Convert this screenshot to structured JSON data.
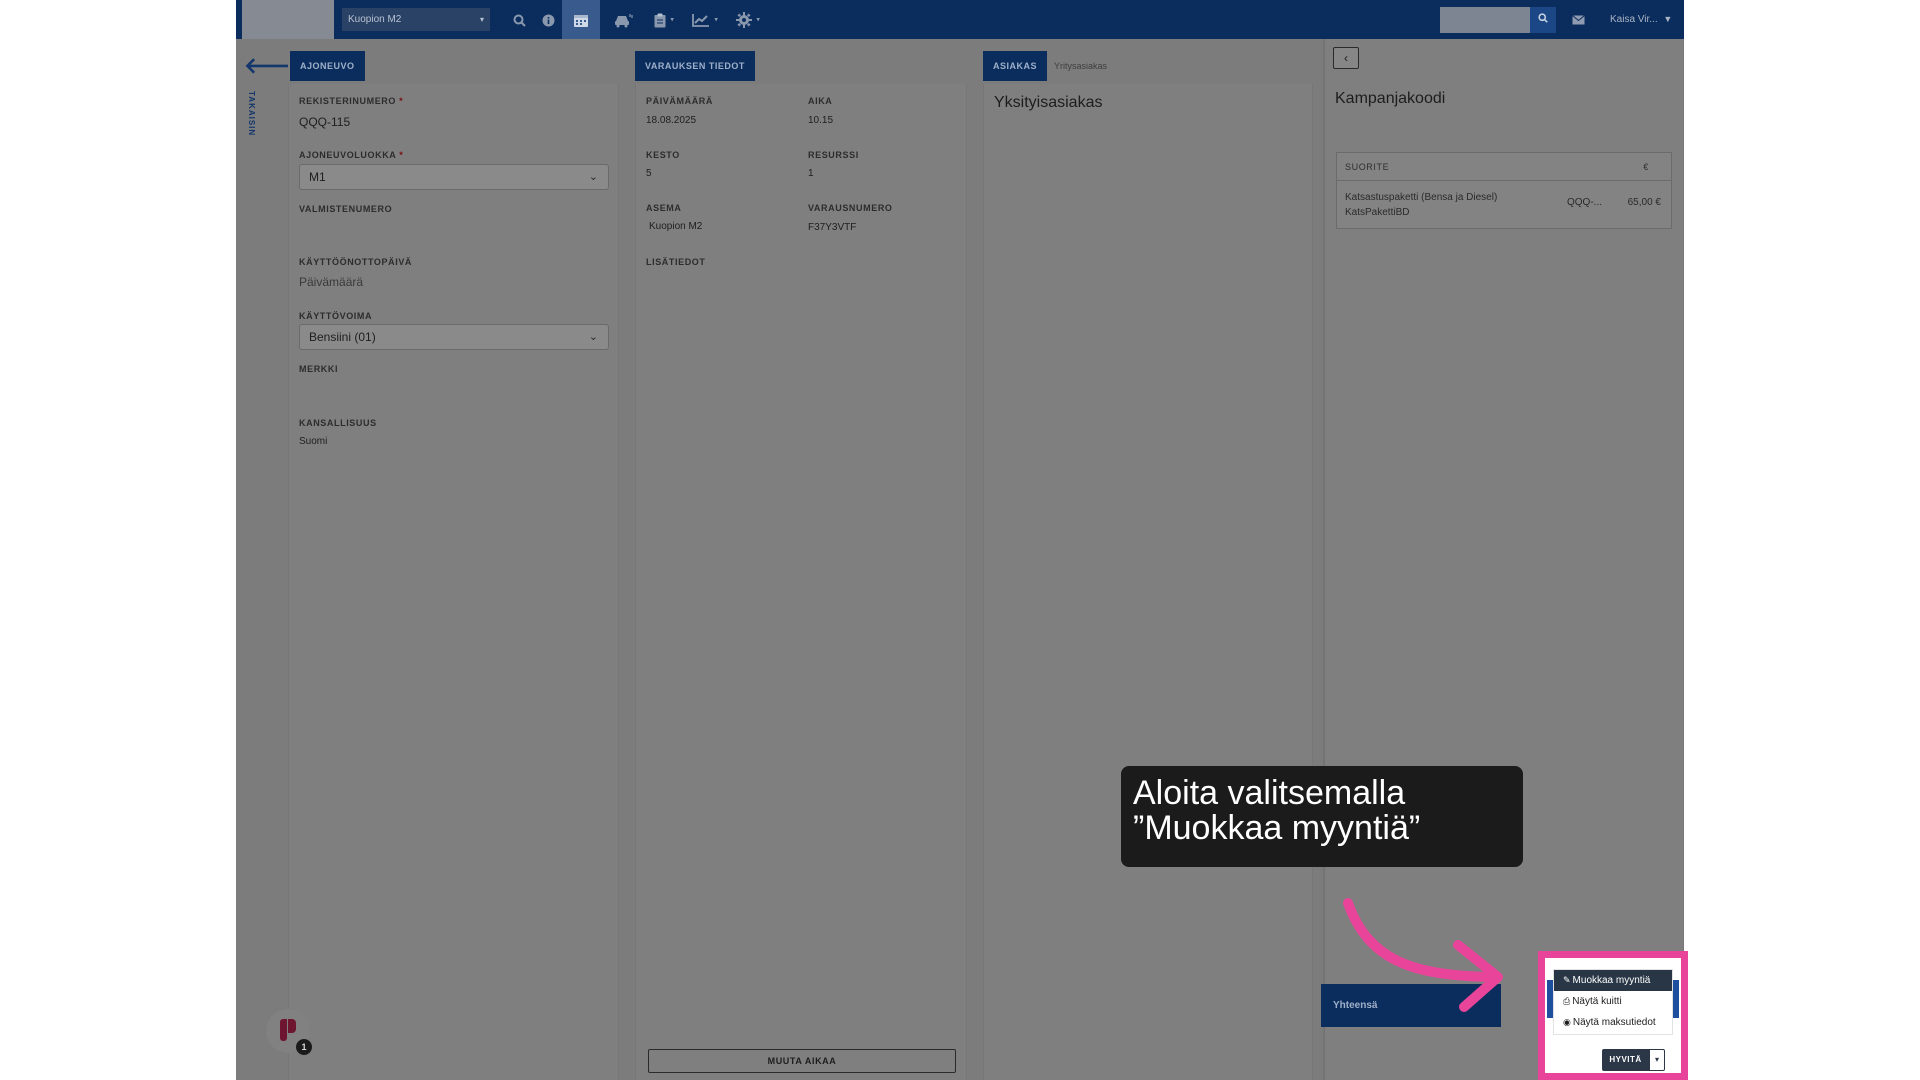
{
  "topbar": {
    "station_select": "Kuopion M2",
    "user_menu_label": "Kaisa Vir...",
    "icons": [
      "search-icon",
      "info-icon",
      "calendar-icon",
      "car-wash-icon",
      "clipboard-icon",
      "chart-icon",
      "gear-icon",
      "mail-icon"
    ]
  },
  "back": {
    "label": "TAKAISIN"
  },
  "vehicle": {
    "tab": "AJONEUVO",
    "reg_label": "REKISTERINUMERO",
    "reg_value": "QQQ-115",
    "class_label": "AJONEUVOLUOKKA",
    "class_value": "M1",
    "manufacturer_label": "VALMISTENUMERO",
    "first_use_label": "KÄYTTÖÖNOTTOPÄIVÄ",
    "first_use_placeholder": "Päivämäärä",
    "fuel_label": "KÄYTTÖVOIMA",
    "fuel_value": "Bensiini (01)",
    "brand_label": "MERKKI",
    "nationality_label": "KANSALLISUUS",
    "nationality_value": "Suomi",
    "required_mark": "*"
  },
  "booking": {
    "tab": "VARAUKSEN TIEDOT",
    "date_label": "PÄIVÄMÄÄRÄ",
    "date_value": "18.08.2025",
    "time_label": "AIKA",
    "time_value": "10.15",
    "duration_label": "KESTO",
    "duration_value": "5",
    "resource_label": "RESURSSI",
    "resource_value": "1",
    "station_label": "ASEMA",
    "station_value": "Kuopion M2",
    "booking_no_label": "VARAUSNUMERO",
    "booking_no_value": "F37Y3VTF",
    "extra_label": "LISÄTIEDOT",
    "change_time_button": "MUUTA AIKAA"
  },
  "customer": {
    "tab_private": "ASIAKAS",
    "tab_company": "Yritysasiakas",
    "title": "Yksityisasiakas"
  },
  "summary": {
    "campaign_title": "Kampanjakoodi",
    "col_item": "SUORITE",
    "col_currency": "€",
    "items": [
      {
        "name": "Katsastuspaketti (Bensa ja Diesel)",
        "code": "KatsPakettiBD",
        "reg": "QQQ-...",
        "price": "65,00 €"
      }
    ],
    "total_label": "Yhteensä"
  },
  "dropdown": {
    "items": [
      {
        "label": "Muokkaa myyntiä",
        "icon": "pencil-icon"
      },
      {
        "label": "Näytä kuitti",
        "icon": "print-icon"
      },
      {
        "label": "Näytä maksutiedot",
        "icon": "eye-icon"
      }
    ],
    "hyvita_button": "HYVITÄ"
  },
  "tooltip": {
    "line1": "Aloita valitsemalla",
    "line2": "”Muokkaa myyntiä”"
  },
  "badge": {
    "count": "1"
  },
  "colors": {
    "navy": "#0b2d5e",
    "highlight": "#e8449a",
    "overlay_gray": "#7c7c7c"
  }
}
